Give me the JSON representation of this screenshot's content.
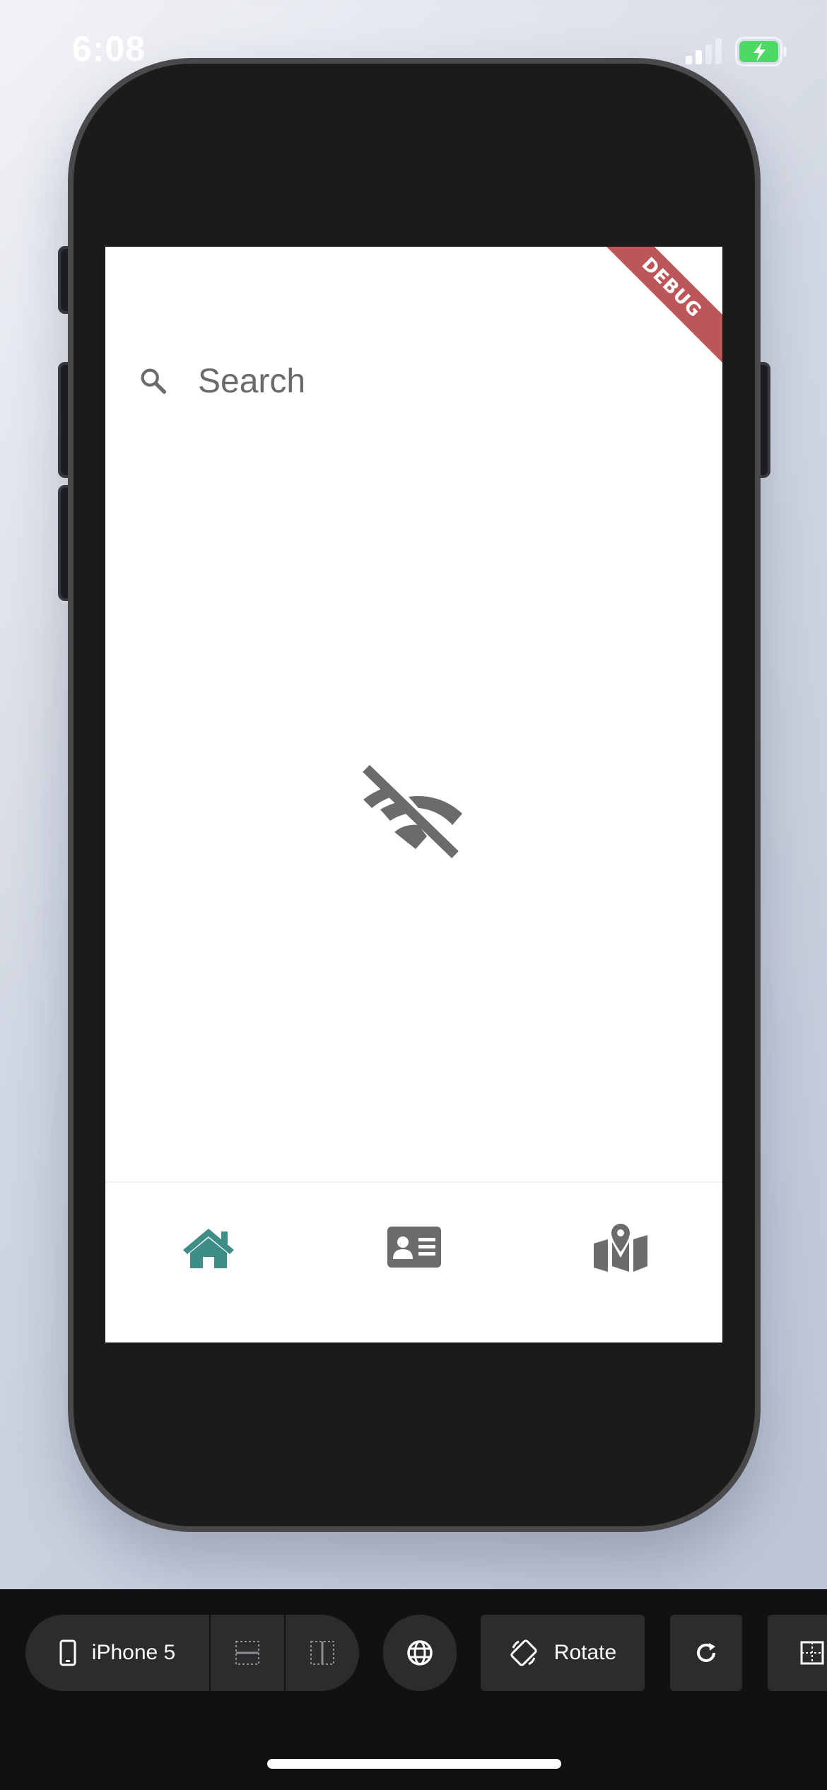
{
  "status_bar": {
    "time": "6:08",
    "signal_icon": "cellular-signal-icon",
    "battery_icon": "battery-charging-icon",
    "battery_color": "#4cd964"
  },
  "app": {
    "debug_banner": "DEBUG",
    "search": {
      "placeholder": "Search",
      "icon": "search-icon"
    },
    "content_state_icon": "wifi-off-icon",
    "bottom_nav": {
      "active_color": "#3e8e87",
      "inactive_color": "#6b6b6b",
      "items": [
        {
          "icon": "home-icon",
          "active": true
        },
        {
          "icon": "contact-card-icon",
          "active": false
        },
        {
          "icon": "map-pin-icon",
          "active": false
        }
      ]
    }
  },
  "toolbar": {
    "device_label": "iPhone 5",
    "rotate_label": "Rotate",
    "icons": [
      "phone-icon",
      "split-vertical-icon",
      "split-horizontal-icon",
      "globe-icon",
      "rotate-icon",
      "restart-icon",
      "more-icon"
    ]
  }
}
